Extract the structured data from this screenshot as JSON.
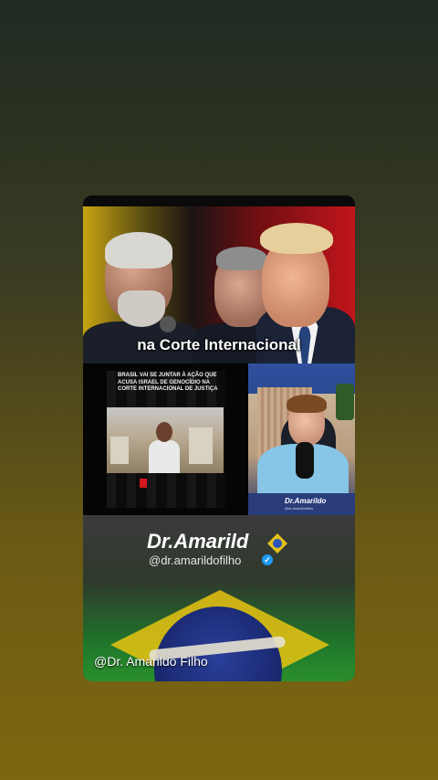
{
  "hero": {
    "caption": "na Corte Internacional"
  },
  "news_panel": {
    "headline": "BRASIL VAI SE JUNTAR À AÇÃO QUE ACUSA ISRAEL DE GENOCÍDIO NA CORTE INTERNACIONAL DE JUSTIÇA"
  },
  "webcam": {
    "label": "Dr.Amarildo",
    "sub": "@dr.amarildofilho"
  },
  "brand": {
    "name": "Dr.Amarild",
    "handle": "@dr.amarildofilho",
    "verified": "✓"
  },
  "watermark": {
    "text": "@Dr. Amarildo Filho"
  },
  "colors": {
    "brand_yellow": "#e3c01a",
    "brand_blue": "#2a55b8",
    "brazil_green": "#2b8f2c",
    "news_red": "#d3171f"
  }
}
